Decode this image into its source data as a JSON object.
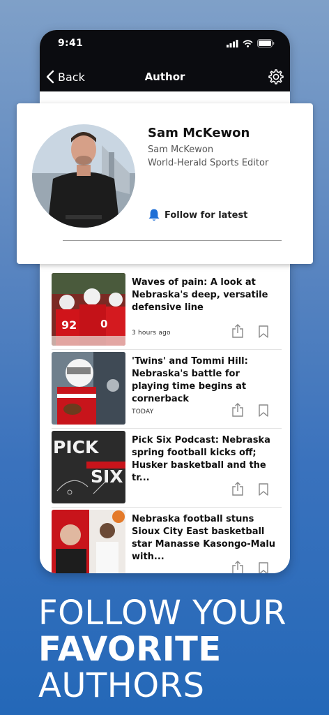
{
  "status_bar": {
    "time": "9:41"
  },
  "nav": {
    "back_label": "Back",
    "title": "Author"
  },
  "author": {
    "name": "Sam McKewon",
    "subname": "Sam McKewon",
    "role": "World-Herald Sports Editor",
    "follow_label": "Follow for latest"
  },
  "articles": [
    {
      "headline": "Waves of pain: A look at Nebraska's deep, versatile defensive line",
      "meta": "3 hours ago",
      "thumb_text": ""
    },
    {
      "headline": "'Twins' and Tommi Hill: Nebraska's battle for playing time begins at cornerback",
      "meta": "TODAY",
      "thumb_text": ""
    },
    {
      "headline": "Pick Six Podcast: Nebraska spring football kicks off; Husker basketball and the tr...",
      "meta": "",
      "thumb_text": "PICK SIX"
    },
    {
      "headline": "Nebraska football stuns Sioux City East basketball star Manasse Kasongo-Malu with...",
      "meta": "",
      "thumb_text": ""
    }
  ],
  "promo": {
    "line1": "FOLLOW YOUR",
    "line2": "FAVORITE",
    "line3": "AUTHORS"
  },
  "colors": {
    "accent_blue": "#1f6fd6",
    "nav_bg": "#0b0c10",
    "husker_red": "#d0141a"
  },
  "icons": [
    "chevron-left-icon",
    "gear-icon",
    "bell-icon",
    "share-icon",
    "bookmark-icon",
    "signal-icon",
    "wifi-icon",
    "battery-icon"
  ]
}
